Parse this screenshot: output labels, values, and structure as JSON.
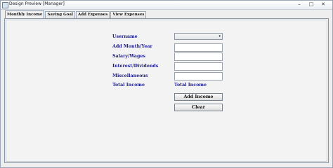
{
  "window": {
    "title": "Design Preview [Manager]",
    "min_glyph": "–",
    "max_glyph": "□",
    "close_glyph": "✕"
  },
  "tabs": [
    {
      "label": "Monthly Income",
      "active": true
    },
    {
      "label": "Saving Goal",
      "active": false
    },
    {
      "label": "Add Expenses",
      "active": false
    },
    {
      "label": "View Expenses",
      "active": false
    }
  ],
  "form": {
    "username_label": "Username",
    "username_value": "",
    "combo_arrow": "▾",
    "month_year_label": "Add Month/Year",
    "month_year_value": "",
    "salary_label": "Salary/Wages",
    "salary_value": "",
    "interest_label": "Interest/Dividends",
    "interest_value": "",
    "misc_label": "Miscellaneous",
    "misc_value": "",
    "total_income_label": "Total Income",
    "total_income_value": "Total Income",
    "add_income_button": "Add Income",
    "clear_button": "Clear"
  },
  "icons": {
    "app": "app-window-icon",
    "combo": "chevron-down-icon"
  }
}
